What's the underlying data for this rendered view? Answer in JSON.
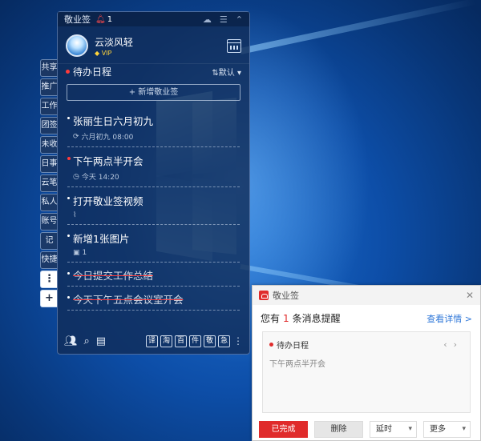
{
  "app": {
    "title": "敬业签",
    "reminder_count": "1",
    "icons": [
      "skin-icon",
      "menu-icon",
      "collapse-icon"
    ]
  },
  "user": {
    "name": "云淡风轻",
    "badge": "VIP"
  },
  "side_tabs": [
    "共享",
    "推广",
    "工作",
    "团签",
    "未收",
    "日事",
    "云笔",
    "私人",
    "账号",
    "记",
    "快捷"
  ],
  "side_tab_more": "⋮",
  "side_tab_add": "+",
  "section": {
    "title": "待办日程",
    "sort_label": "默认"
  },
  "add_button": "+ 新增敬业签",
  "notes": [
    {
      "text": "张丽生日六月初九",
      "meta_icon": "repeat-icon",
      "meta": "六月初九 08:00",
      "important": false,
      "done": false
    },
    {
      "text": "下午两点半开会",
      "meta_icon": "clock-icon",
      "meta": "今天 14:20",
      "important": true,
      "done": false
    },
    {
      "text": "打开敬业签视频",
      "meta_icon": "attachment-icon",
      "meta": "",
      "important": false,
      "done": false
    },
    {
      "text": "新增1张图片",
      "meta_icon": "image-icon",
      "meta": "1",
      "important": false,
      "done": false
    },
    {
      "text": "今日提交工作总结",
      "meta_icon": "",
      "meta": "",
      "important": false,
      "done": true
    },
    {
      "text": "今天下午五点会议室开会",
      "meta_icon": "",
      "meta": "",
      "important": false,
      "done": true
    }
  ],
  "bottom_tools": [
    "译",
    "淘",
    "百",
    "件",
    "敬",
    "急"
  ],
  "popup": {
    "app_name": "敬业签",
    "message_prefix": "您有",
    "message_count": "1",
    "message_suffix": "条消息提醒",
    "details_link": "查看详情 >",
    "card_title": "待办日程",
    "card_body": "下午两点半开会",
    "btn_done": "已完成",
    "btn_delete": "删除",
    "btn_delay": "延时",
    "btn_more": "更多"
  },
  "colors": {
    "accent_red": "#e02b2b",
    "link_blue": "#2f77d8",
    "panel_bg": "#102c58"
  }
}
